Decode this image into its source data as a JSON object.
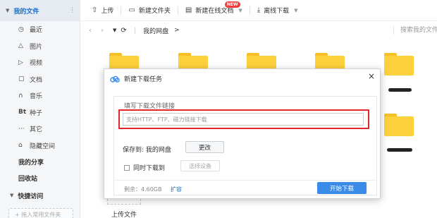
{
  "sidebar": {
    "my_files": "我的文件",
    "more": "⋮",
    "items": [
      {
        "icon": "clock-icon",
        "glyph": "◷",
        "label": "最近"
      },
      {
        "icon": "image-icon",
        "glyph": "△",
        "label": "图片"
      },
      {
        "icon": "video-icon",
        "glyph": "▷",
        "label": "视频"
      },
      {
        "icon": "document-icon",
        "glyph": "▢",
        "label": "文档"
      },
      {
        "icon": "music-icon",
        "glyph": "∩",
        "label": "音乐"
      },
      {
        "icon": "bt-icon",
        "glyph": "Bt",
        "label": "种子"
      },
      {
        "icon": "more-dots-icon",
        "glyph": "···",
        "label": "其它"
      },
      {
        "icon": "lock-icon",
        "glyph": "⌂",
        "label": "隐藏空间"
      }
    ],
    "my_share": "我的分享",
    "recycle_bin": "回收站",
    "quick_access": "快捷访问",
    "drop_hint": "+ 拖入常用文件夹"
  },
  "toolbar": {
    "upload": "上传",
    "new_folder": "新建文件夹",
    "new_online_doc": "新建在线文档",
    "new_badge": "NEW",
    "offline_download": "离线下载"
  },
  "nav": {
    "breadcrumb_root": "我的网盘",
    "breadcrumb_arrow": ">",
    "search_placeholder": "搜索我的文件"
  },
  "files": {
    "upload_label": "上传文件"
  },
  "dialog": {
    "title": "新建下载任务",
    "field_label": "填写下载文件链接",
    "input_placeholder": "支持HTTP、FTP、磁力链接下载",
    "input_value": "",
    "save_to_label": "保存到: 我的网盘",
    "change_button": "更改",
    "sync_download_label": "同时下载到",
    "sync_download_checked": false,
    "select_device_button": "选择设备",
    "remaining": "剩余：4.60GB",
    "expand_link": "扩容",
    "start_button": "开始下载"
  },
  "colors": {
    "accent": "#3b8be8",
    "highlight_border": "#e4262b",
    "folder": "#fdd13b",
    "new_badge": "#ef3c3c"
  }
}
